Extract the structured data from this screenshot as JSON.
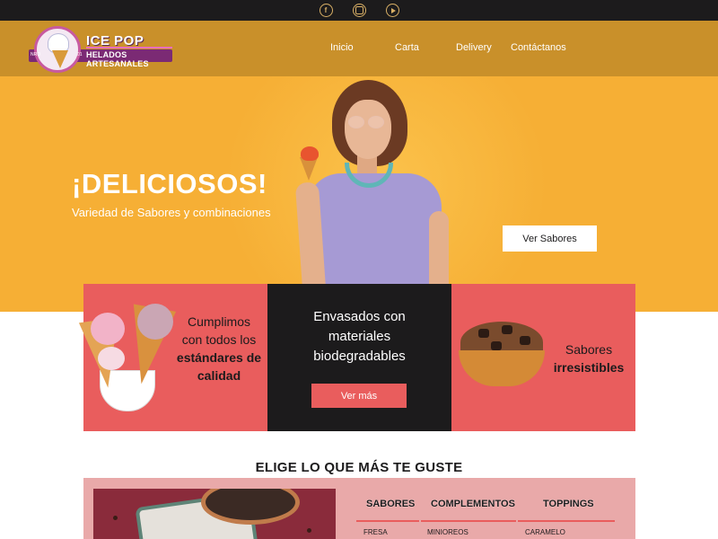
{
  "social": {
    "icons": [
      "facebook-icon",
      "instagram-icon",
      "youtube-icon"
    ],
    "facebook_glyph": "f"
  },
  "brand": {
    "name": "ICE POP",
    "tagline": "HELADOS ARTESANALES",
    "badge_left": "NRO",
    "badge_right": "01"
  },
  "nav": {
    "items": [
      {
        "label": "Inicio"
      },
      {
        "label": "Carta"
      },
      {
        "label": "Delivery"
      },
      {
        "label": "Contáctanos"
      }
    ]
  },
  "hero": {
    "title": "¡DELICIOSOS!",
    "subtitle": "Variedad de Sabores y combinaciones",
    "button_label": "Ver Sabores"
  },
  "cards": {
    "left": {
      "line1": "Cumplimos con todos los",
      "line2": "estándares de calidad"
    },
    "middle": {
      "text": "Envasados con materiales biodegradables",
      "button_label": "Ver más"
    },
    "right": {
      "line1": "Sabores",
      "line2": "irresistibles"
    }
  },
  "section": {
    "title": "ELIGE LO QUE MÁS TE GUSTE"
  },
  "menu": {
    "columns": [
      {
        "header": "SABORES",
        "first_item": "FRESA"
      },
      {
        "header": "COMPLEMENTOS",
        "first_item": "MINIOREOS"
      },
      {
        "header": "TOPPINGS",
        "first_item": "CARAMELO"
      }
    ]
  },
  "colors": {
    "topbar": "#1c1b1c",
    "header": "#c9902a",
    "hero_bg": "#f6af35",
    "accent_red": "#e95d5d",
    "menu_bg": "#e9a9a9"
  }
}
